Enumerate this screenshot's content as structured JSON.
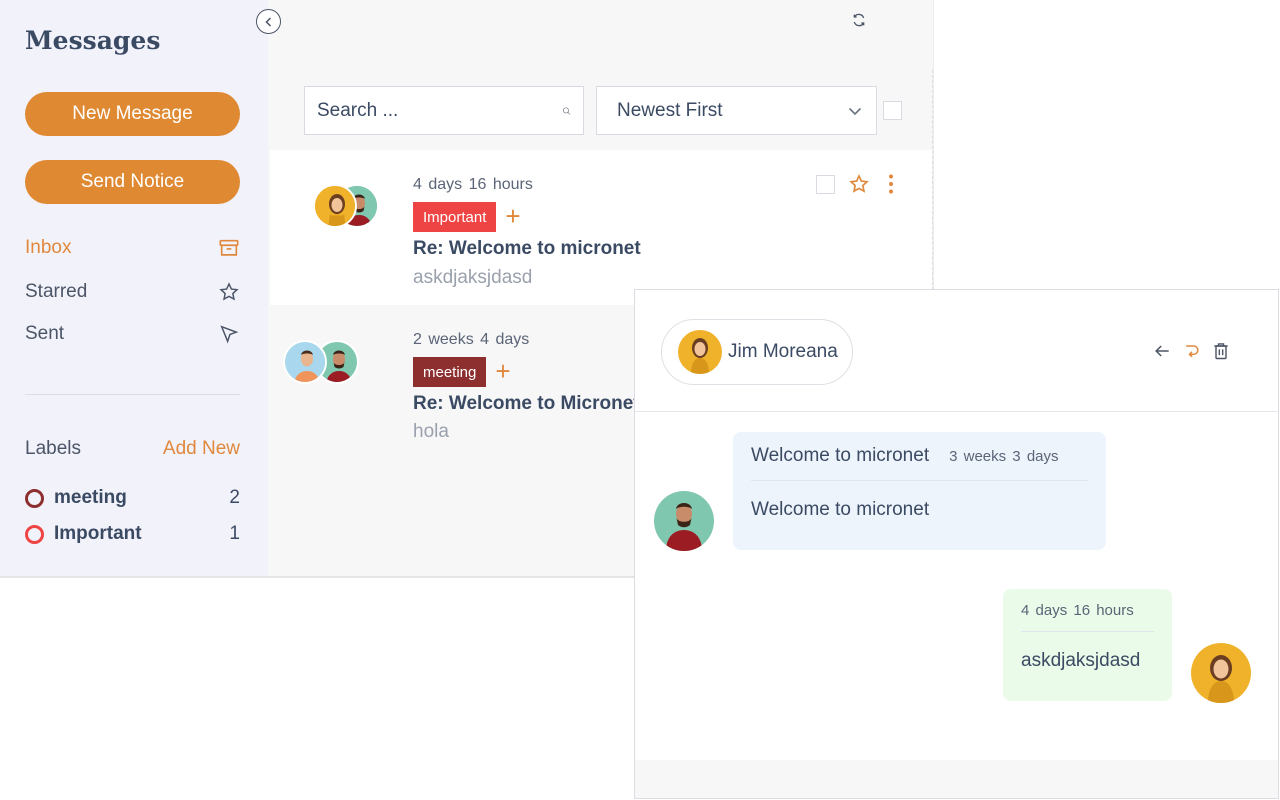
{
  "sidebar": {
    "title": "Messages",
    "new_message": "New Message",
    "send_notice": "Send Notice",
    "nav": [
      {
        "label": "Inbox",
        "icon": "archive-icon",
        "active": true
      },
      {
        "label": "Starred",
        "icon": "star-icon",
        "active": false
      },
      {
        "label": "Sent",
        "icon": "send-icon",
        "active": false
      }
    ],
    "labels_title": "Labels",
    "labels_add": "Add New",
    "labels": [
      {
        "name": "meeting",
        "count": "2",
        "color": "#8e2f2f"
      },
      {
        "name": "Important",
        "count": "1",
        "color": "#ee4444"
      }
    ]
  },
  "toolbar": {
    "search_placeholder": "Search ...",
    "sort_selected": "Newest First"
  },
  "messages": [
    {
      "time": "4 days  16 hours",
      "tag": "Important",
      "tag_color": "#ee4444",
      "subject": "Re: Welcome to micronet",
      "preview": "askdjaksjdasd"
    },
    {
      "time": "2 weeks  4 days",
      "tag": "meeting",
      "tag_color": "#8e2f2f",
      "subject": "Re: Welcome to Micronet",
      "preview": "hola"
    }
  ],
  "conversation": {
    "contact": "Jim Moreana",
    "incoming": {
      "title": "Welcome to micronet",
      "time": "3 weeks  3 days",
      "text": "Welcome to micronet"
    },
    "outgoing": {
      "time": "4 days  16 hours",
      "text": "askdjaksjdasd"
    }
  },
  "colors": {
    "accent": "#df8a33",
    "text": "#3b4a63",
    "muted": "#9aa1ad"
  }
}
